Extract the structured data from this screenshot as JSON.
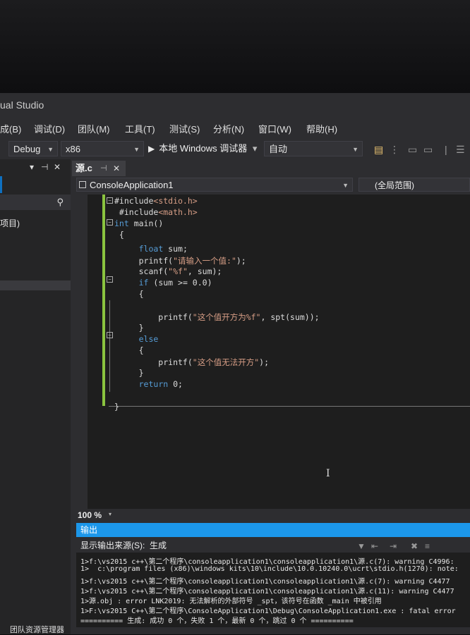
{
  "window": {
    "title": "ual Studio"
  },
  "menu": [
    "成(B)",
    "调试(D)",
    "团队(M)",
    "工具(T)",
    "测试(S)",
    "分析(N)",
    "窗口(W)",
    "帮助(H)"
  ],
  "toolbar": {
    "config": "Debug",
    "platform": "x86",
    "run_label": "本地 Windows 调试器",
    "run_dropdown_arrow": "▾",
    "mode": "自动"
  },
  "left_panel": {
    "item_text": "项目)"
  },
  "editor_tab": {
    "name": "源.c",
    "pin": "⊣",
    "close": "✕"
  },
  "navigation": {
    "project": "ConsoleApplication1",
    "scope": "(全局范围)"
  },
  "code_lines": [
    {
      "parts": [
        {
          "t": "#include",
          "c": "plain"
        },
        {
          "t": "<stdio.h>",
          "c": "inc"
        }
      ]
    },
    {
      "parts": [
        {
          "t": " #include",
          "c": "plain"
        },
        {
          "t": "<math.h>",
          "c": "inc"
        }
      ]
    },
    {
      "parts": [
        {
          "t": "int",
          "c": "kw"
        },
        {
          "t": " main()",
          "c": "plain"
        }
      ]
    },
    {
      "parts": [
        {
          "t": " {",
          "c": "plain"
        }
      ]
    },
    {
      "parts": [
        {
          "t": "     ",
          "c": "plain"
        },
        {
          "t": "float",
          "c": "kw"
        },
        {
          "t": " sum;",
          "c": "plain"
        }
      ]
    },
    {
      "parts": [
        {
          "t": "     printf(",
          "c": "plain"
        },
        {
          "t": "\"请输入一个值:\"",
          "c": "str"
        },
        {
          "t": ");",
          "c": "plain"
        }
      ]
    },
    {
      "parts": [
        {
          "t": "     scanf(",
          "c": "plain"
        },
        {
          "t": "\"%f\"",
          "c": "str"
        },
        {
          "t": ", sum);",
          "c": "plain"
        }
      ]
    },
    {
      "parts": [
        {
          "t": "     ",
          "c": "plain"
        },
        {
          "t": "if",
          "c": "kw"
        },
        {
          "t": " (sum >= 0.0)",
          "c": "plain"
        }
      ]
    },
    {
      "parts": [
        {
          "t": "     {",
          "c": "plain"
        }
      ]
    },
    {
      "parts": [
        {
          "t": "",
          "c": "plain"
        }
      ]
    },
    {
      "parts": [
        {
          "t": "         printf(",
          "c": "plain"
        },
        {
          "t": "\"这个值开方为%f\"",
          "c": "str"
        },
        {
          "t": ", spt(sum));",
          "c": "plain"
        }
      ]
    },
    {
      "parts": [
        {
          "t": "     }",
          "c": "plain"
        }
      ]
    },
    {
      "parts": [
        {
          "t": "     ",
          "c": "plain"
        },
        {
          "t": "else",
          "c": "kw"
        }
      ]
    },
    {
      "parts": [
        {
          "t": "     {",
          "c": "plain"
        }
      ]
    },
    {
      "parts": [
        {
          "t": "         printf(",
          "c": "plain"
        },
        {
          "t": "\"这个值无法开方\"",
          "c": "str"
        },
        {
          "t": ");",
          "c": "plain"
        }
      ]
    },
    {
      "parts": [
        {
          "t": "     }",
          "c": "plain"
        }
      ]
    },
    {
      "parts": [
        {
          "t": "     ",
          "c": "plain"
        },
        {
          "t": "return",
          "c": "kw"
        },
        {
          "t": " 0;",
          "c": "plain"
        }
      ]
    },
    {
      "parts": [
        {
          "t": "",
          "c": "plain"
        }
      ]
    },
    {
      "parts": [
        {
          "t": "}",
          "c": "plain"
        }
      ]
    }
  ],
  "zoom": {
    "value": "100 %",
    "arrow": "▾"
  },
  "output": {
    "title": "输出",
    "source_label": "显示输出来源(S):",
    "source_value": "生成",
    "lines": [
      "1>f:\\vs2015 c++\\第二个程序\\consoleapplication1\\consoleapplication1\\源.c(7): warning C4996:",
      "1>  c:\\program files (x86)\\windows kits\\10\\include\\10.0.10240.0\\ucrt\\stdio.h(1270): note:",
      "1>f:\\vs2015 c++\\第二个程序\\consoleapplication1\\consoleapplication1\\源.c(7): warning C4477",
      "1>f:\\vs2015 c++\\第二个程序\\consoleapplication1\\consoleapplication1\\源.c(11): warning C4477",
      "1>源.obj : error LNK2019: 无法解析的外部符号 _spt，该符号在函数 _main 中被引用",
      "1>F:\\vs2015 C++\\第二个程序\\ConsoleApplication1\\Debug\\ConsoleApplication1.exe : fatal error",
      "========== 生成: 成功 0 个，失败 1 个，最新 0 个，跳过 0 个 =========="
    ]
  },
  "status": {
    "team_explorer": "团队资源管理器"
  }
}
